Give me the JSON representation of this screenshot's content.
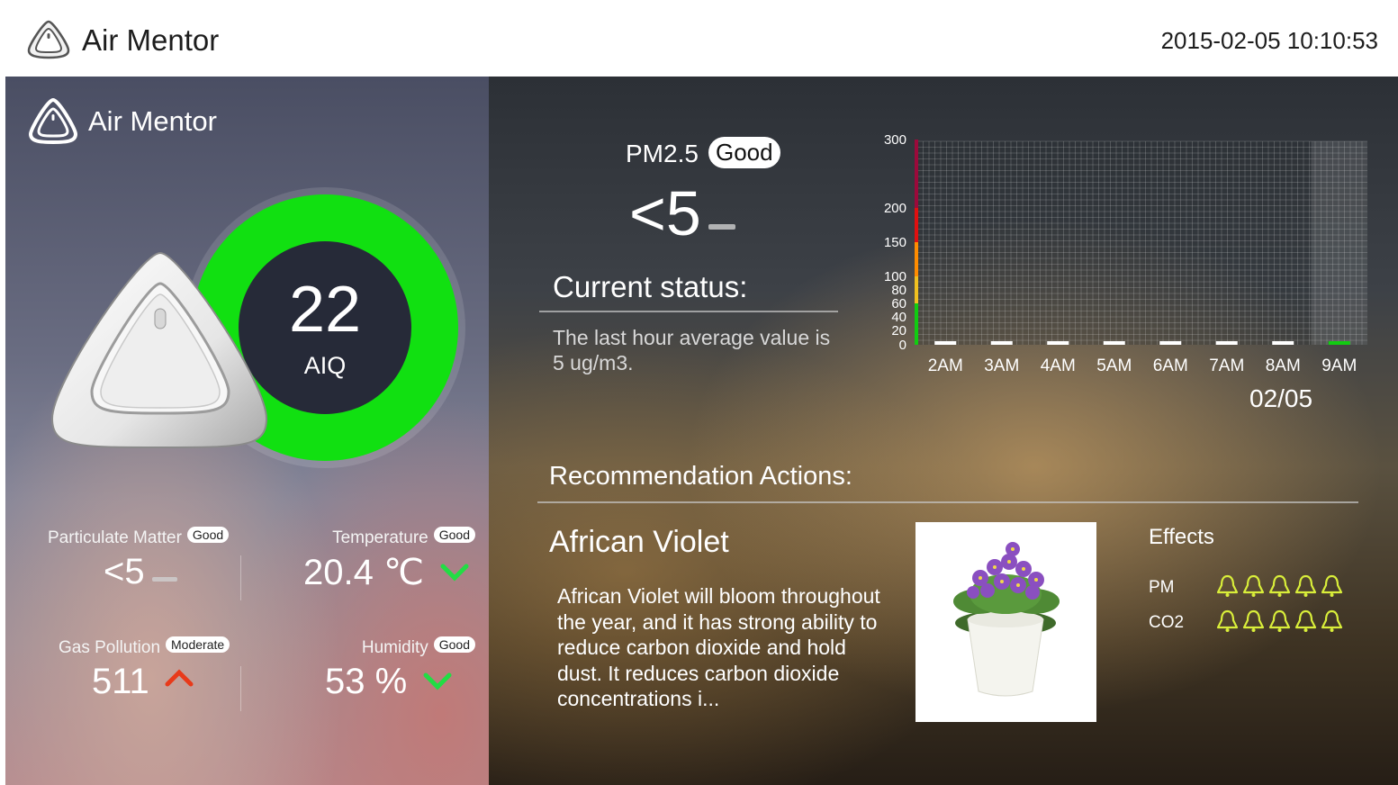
{
  "topbar": {
    "title": "Air Mentor",
    "datetime": "2015-02-05 10:10:53",
    "logo_icon": "air-mentor-logo-icon"
  },
  "left": {
    "brand": "Air Mentor",
    "aiq": {
      "value": "22",
      "label": "AIQ",
      "ring_color": "#11e011"
    },
    "metrics": {
      "pm": {
        "label": "Particulate Matter",
        "badge": "Good",
        "value": "<5"
      },
      "temp": {
        "label": "Temperature",
        "badge": "Good",
        "value": "20.4 ℃",
        "trend": "down-check-icon"
      },
      "gas": {
        "label": "Gas Pollution",
        "badge": "Moderate",
        "value": "511",
        "trend": "up-arrow-icon"
      },
      "humidity": {
        "label": "Humidity",
        "badge": "Good",
        "value": "53 %",
        "trend": "down-check-icon"
      }
    }
  },
  "pm25": {
    "title": "PM2.5",
    "badge": "Good",
    "value": "<5",
    "status_title": "Current status:",
    "status_text": "The last hour average value is 5 ug/m3."
  },
  "chart_data": {
    "type": "bar",
    "categories": [
      "2AM",
      "3AM",
      "4AM",
      "5AM",
      "6AM",
      "7AM",
      "8AM",
      "9AM"
    ],
    "values": [
      5,
      5,
      5,
      5,
      5,
      5,
      5,
      5
    ],
    "yticks": [
      "300",
      "200",
      "150",
      "100",
      "80",
      "60",
      "40",
      "20",
      "0"
    ],
    "ylim": [
      0,
      300
    ],
    "date_label": "02/05",
    "bar_colors": [
      "#ffffff",
      "#ffffff",
      "#ffffff",
      "#ffffff",
      "#ffffff",
      "#ffffff",
      "#ffffff",
      "#11cc11"
    ],
    "scale_colors": [
      "#11cc11",
      "#f0c020",
      "#ff8c00",
      "#e01010",
      "#9b0a3b"
    ],
    "grid": true
  },
  "recommendation": {
    "title": "Recommendation Actions:",
    "plant_name": "African Violet",
    "plant_desc": "African Violet will bloom throughout the year, and it has strong ability to reduce carbon dioxide and hold dust. It reduces carbon dioxide concentrations i...",
    "effects_title": "Effects",
    "effects": [
      {
        "label": "PM",
        "level": 5,
        "icon": "bell-icon"
      },
      {
        "label": "CO2",
        "level": 5,
        "icon": "bell-icon"
      }
    ],
    "effect_color": "#d9ee3a"
  }
}
